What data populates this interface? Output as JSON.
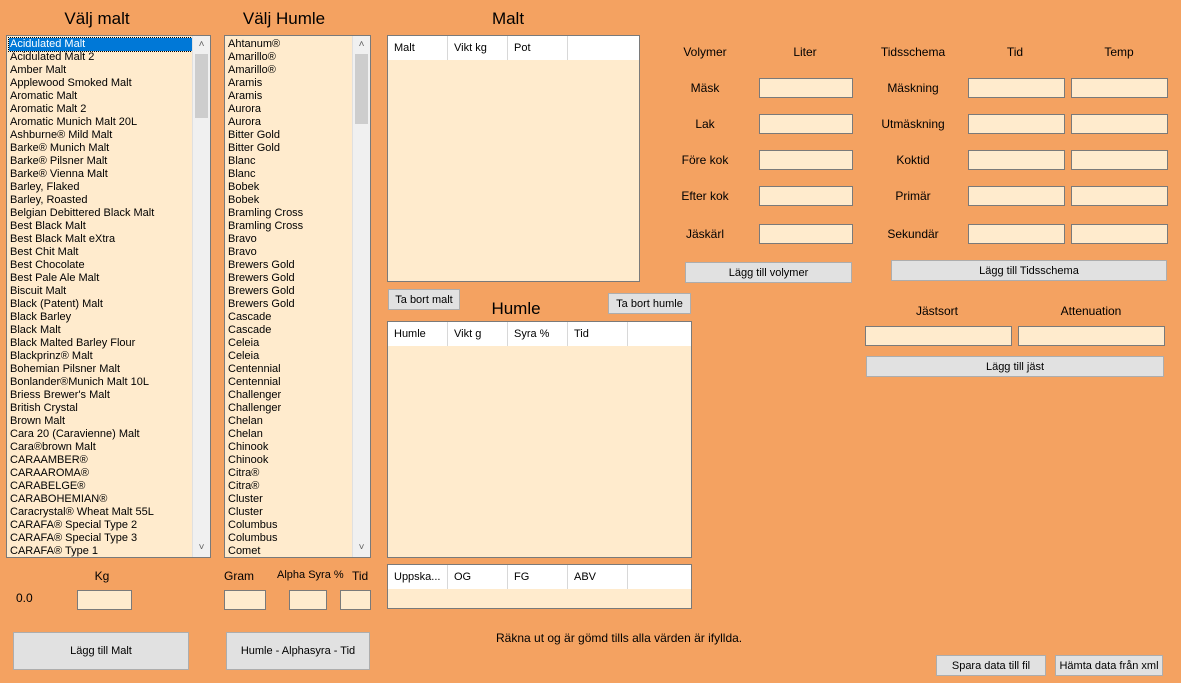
{
  "malt_panel": {
    "title": "Välj malt",
    "items": [
      "Acidulated Malt",
      "Acidulated Malt 2",
      "Amber Malt",
      "Applewood Smoked Malt",
      "Aromatic Malt",
      "Aromatic Malt 2",
      "Aromatic Munich Malt 20L",
      "Ashburne® Mild Malt",
      "Barke® Munich Malt",
      "Barke® Pilsner Malt",
      "Barke® Vienna Malt",
      "Barley, Flaked",
      "Barley, Roasted",
      "Belgian Debittered Black Malt",
      "Best Black Malt",
      "Best Black Malt eXtra",
      "Best Chit Malt",
      "Best Chocolate",
      "Best Pale Ale Malt",
      "Biscuit Malt",
      "Black (Patent) Malt",
      "Black Barley",
      "Black Malt",
      "Black Malted Barley Flour",
      "Blackprinz® Malt",
      "Bohemian Pilsner Malt",
      "Bonlander®Munich Malt 10L",
      "Briess Brewer's Malt",
      "British Crystal",
      "Brown Malt",
      "Cara 20 (Caravienne) Malt",
      "Cara®brown Malt",
      "CARAAMBER®",
      "CARAAROMA®",
      "CARABELGE®",
      "CARABOHEMIAN®",
      "Caracrystal® Wheat Malt 55L",
      "CARAFA® Special Type 2",
      "CARAFA® Special Type 3",
      "CARAFA® Type 1"
    ],
    "kg_label": "Kg",
    "total_value": "0.0",
    "add_button": "Lägg till Malt"
  },
  "hops_panel": {
    "title": "Välj Humle",
    "items": [
      "Ahtanum®",
      "Amarillo®",
      "Amarillo®",
      "Aramis",
      "Aramis",
      "Aurora",
      "Aurora",
      "Bitter Gold",
      "Bitter Gold",
      "Blanc",
      "Blanc",
      "Bobek",
      "Bobek",
      "Bramling Cross",
      "Bramling Cross",
      "Bravo",
      "Bravo",
      "Brewers Gold",
      "Brewers Gold",
      "Brewers Gold",
      "Brewers Gold",
      "Cascade",
      "Cascade",
      "Celeia",
      "Celeia",
      "Centennial",
      "Centennial",
      "Challenger",
      "Challenger",
      "Chelan",
      "Chelan",
      "Chinook",
      "Chinook",
      "Citra®",
      "Citra®",
      "Cluster",
      "Cluster",
      "Columbus",
      "Columbus",
      "Comet"
    ],
    "gram_label": "Gram",
    "alpha_label": "Alpha Syra %",
    "tid_label": "Tid",
    "add_button": "Humle - Alphasyra - Tid"
  },
  "malt_grid": {
    "title": "Malt",
    "columns": [
      "Malt",
      "Vikt kg",
      "Pot"
    ],
    "remove_button": "Ta bort malt"
  },
  "hops_grid": {
    "title": "Humle",
    "columns": [
      "Humle",
      "Vikt g",
      "Syra %",
      "Tid"
    ],
    "remove_button": "Ta bort humle"
  },
  "result_grid": {
    "columns": [
      "Uppska...",
      "OG",
      "FG",
      "ABV"
    ]
  },
  "note": "Räkna ut og är gömd tills alla värden är ifyllda.",
  "volumes": {
    "header": "Volymer",
    "unit": "Liter",
    "rows": [
      "Mäsk",
      "Lak",
      "Före kok",
      "Efter kok",
      "Jäskärl"
    ],
    "add_button": "Lägg till volymer"
  },
  "schedule": {
    "header": "Tidsschema",
    "col_time": "Tid",
    "col_temp": "Temp",
    "rows": [
      "Mäskning",
      "Utmäskning",
      "Koktid",
      "Primär",
      "Sekundär"
    ],
    "add_button": "Lägg till Tidsschema"
  },
  "yeast": {
    "strain_label": "Jästsort",
    "attenuation_label": "Attenuation",
    "add_button": "Lägg till jäst"
  },
  "file_buttons": {
    "save": "Spara data till fil",
    "load": "Hämta data från xml"
  },
  "colors": {
    "background": "#f4a261",
    "field": "#ffebcd",
    "button": "#e1e1e1",
    "selection": "#0078d7"
  }
}
